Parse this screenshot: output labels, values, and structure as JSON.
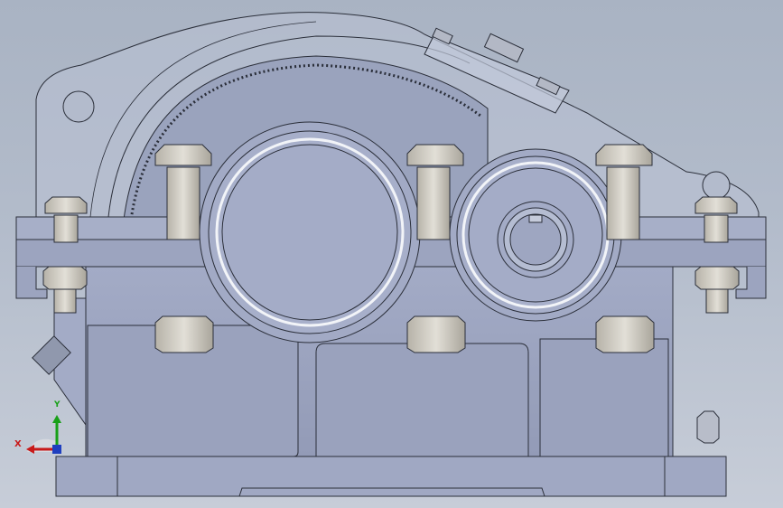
{
  "window": {
    "title": ""
  },
  "model": {
    "name": "",
    "view": "front",
    "colors": {
      "background_top": "#a9b3c3",
      "background_bottom": "#c7cdd8",
      "housing_fill": "#9ea6c2",
      "housing_dark": "#8c93ae",
      "edge": "#2b2f3a",
      "cover_fill": "#b7c0d3",
      "gear_fill": "#9aa3bd",
      "bolt_fill": "#c9c6bd",
      "axis_x": "#c81a1a",
      "axis_y": "#18a018",
      "axis_z": "#1f3fbf"
    }
  },
  "triad": {
    "x_label": "X",
    "y_label": "Y"
  }
}
